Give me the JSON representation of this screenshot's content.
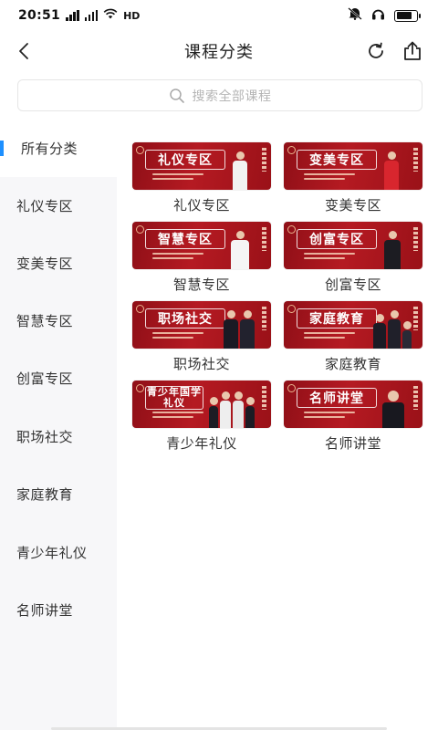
{
  "status_bar": {
    "time": "20:51",
    "network": "HD"
  },
  "nav": {
    "title": "课程分类",
    "icons": {
      "back": "chevron-left-icon",
      "refresh": "refresh-icon",
      "share": "share-icon"
    }
  },
  "search": {
    "placeholder": "搜索全部课程"
  },
  "sidebar": {
    "items": [
      {
        "label": "所有分类",
        "active": true
      },
      {
        "label": "礼仪专区"
      },
      {
        "label": "变美专区"
      },
      {
        "label": "智慧专区"
      },
      {
        "label": "创富专区"
      },
      {
        "label": "职场社交"
      },
      {
        "label": "家庭教育"
      },
      {
        "label": "青少年礼仪"
      },
      {
        "label": "名师讲堂"
      }
    ]
  },
  "grid": {
    "items": [
      {
        "label": "礼仪专区",
        "banner": "礼仪专区"
      },
      {
        "label": "变美专区",
        "banner": "变美专区"
      },
      {
        "label": "智慧专区",
        "banner": "智慧专区"
      },
      {
        "label": "创富专区",
        "banner": "创富专区"
      },
      {
        "label": "职场社交",
        "banner": "职场社交"
      },
      {
        "label": "家庭教育",
        "banner": "家庭教育"
      },
      {
        "label": "青少年礼仪",
        "banner": "青少年国学礼仪"
      },
      {
        "label": "名师讲堂",
        "banner": "名师讲堂"
      }
    ]
  },
  "colors": {
    "accent": "#1e90ff",
    "banner_red": "#b51a22",
    "sidebar_bg": "#f7f7f9"
  }
}
